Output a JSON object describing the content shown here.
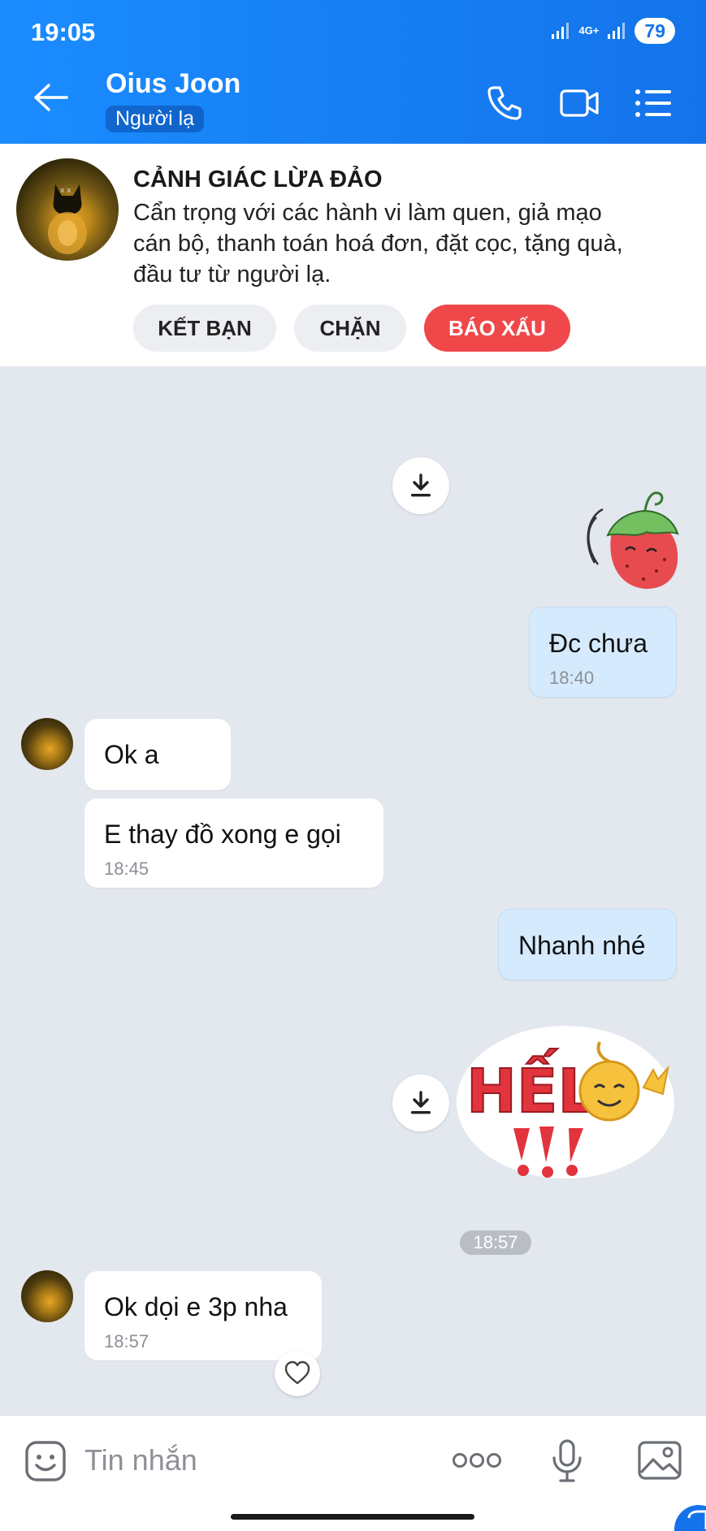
{
  "status_bar": {
    "time": "19:05",
    "network": "4G+",
    "battery": "79"
  },
  "header": {
    "contact_name": "Oius Joon",
    "contact_tag": "Người lạ",
    "icons": [
      "back-arrow",
      "phone",
      "video-camera",
      "list-menu"
    ]
  },
  "warning": {
    "title": "CẢNH GIÁC LỪA ĐẢO",
    "lines": [
      "Cẩn trọng với các hành vi làm quen, giả mạo",
      "cán bộ, thanh toán hoá đơn, đặt cọc, tặng quà,",
      "đầu tư từ người lạ."
    ],
    "actions": {
      "add_friend": "KẾT BẠN",
      "block": "CHẶN",
      "report": "BÁO XẤU"
    }
  },
  "messages": [
    {
      "sender": "me",
      "type": "sticker",
      "sticker": "strawberry"
    },
    {
      "sender": "me",
      "text": "Đc chưa",
      "time": "18:40"
    },
    {
      "sender": "them",
      "text": "Ok a"
    },
    {
      "sender": "them",
      "text": "E thay đồ xong e gọi",
      "time": "18:45"
    },
    {
      "sender": "me",
      "text": "Nhanh nhé"
    },
    {
      "sender": "me",
      "type": "sticker",
      "sticker": "HẾLO",
      "sticker_text": "HẾL"
    },
    {
      "type": "separator",
      "time": "18:57"
    },
    {
      "sender": "them",
      "text": "Ok dọi e 3p nha",
      "time": "18:57"
    }
  ],
  "composer": {
    "placeholder": "Tin nhắn"
  },
  "colors": {
    "header": "#1473ea",
    "report": "#f0474a",
    "my_bubble": "#d5eafd",
    "chat_bg": "#e3e7ee"
  }
}
